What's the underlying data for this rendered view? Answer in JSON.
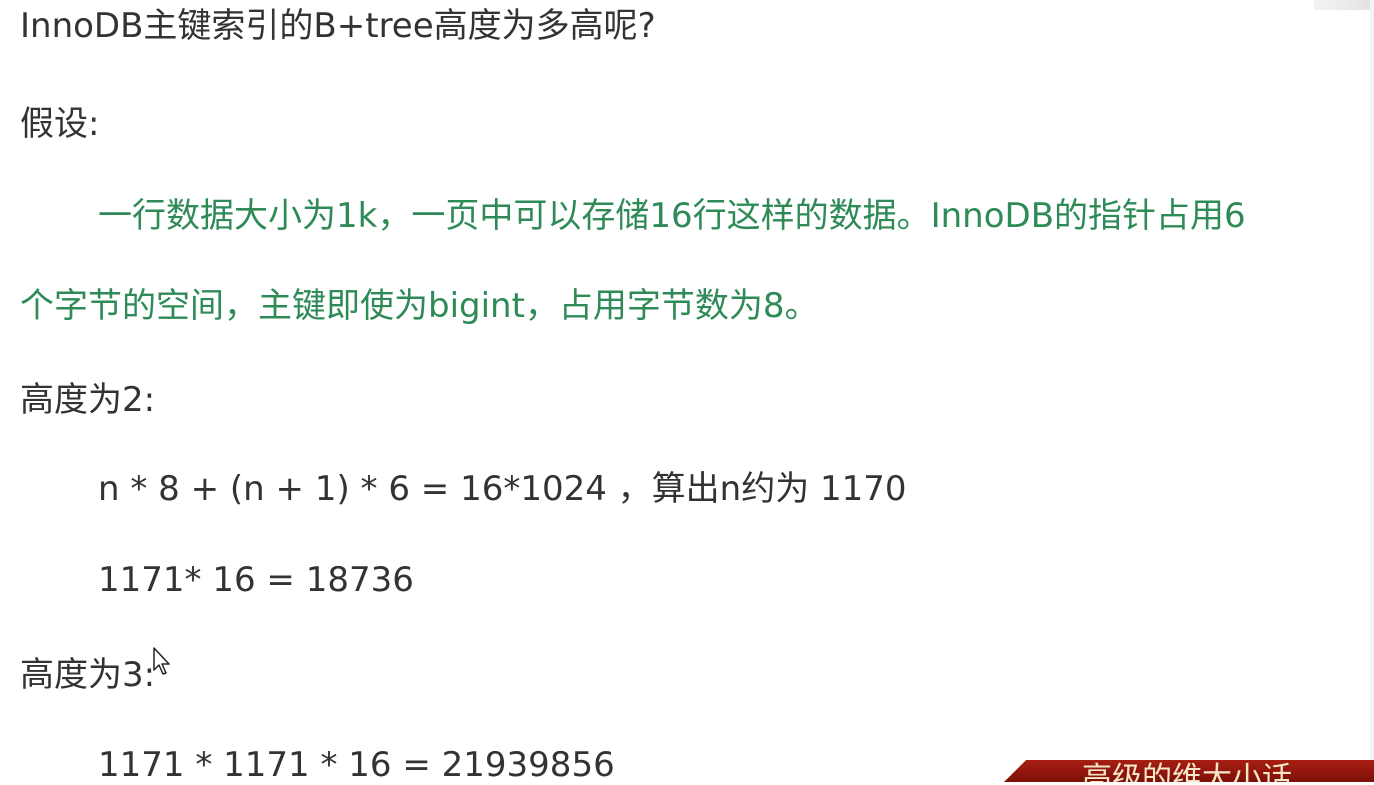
{
  "doc": {
    "title": "InnoDB主键索引的B+tree高度为多高呢?",
    "assume_label": "假设:",
    "assumption_line1": "一行数据大小为1k，一页中可以存储16行这样的数据。InnoDB的指针占用6",
    "assumption_line2": "个字节的空间，主键即使为bigint，占用字节数为8。",
    "height2_label": "高度为2:",
    "height2_formula": "n * 8 + (n + 1) * 6 = 16*1024  ，算出n约为 1170",
    "height2_result": "1171* 16 = 18736",
    "height3_label": "高度为3:",
    "height3_result": "1171 * 1171 * 16 = 21939856"
  },
  "overlay": {
    "banner_text": "高级的维大小话"
  },
  "colors": {
    "body_text": "#333333",
    "green_text": "#2e8b57",
    "banner_bg": "#a81e12",
    "banner_text": "#f5e6c8"
  }
}
